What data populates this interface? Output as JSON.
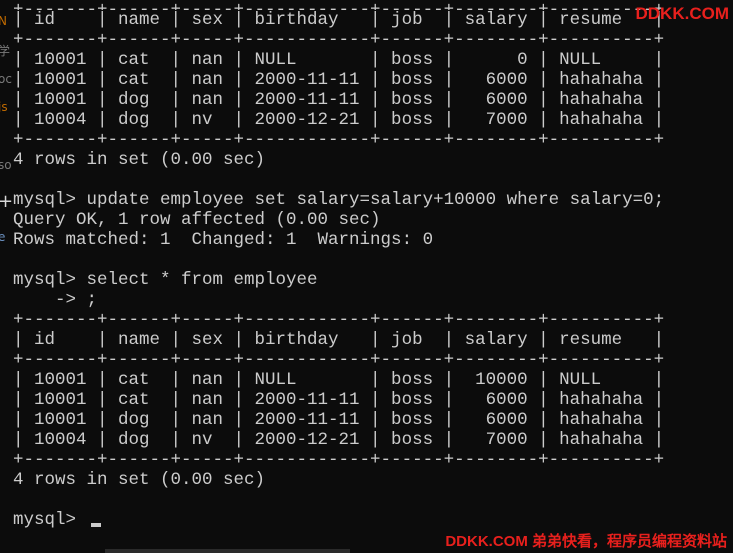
{
  "terminal": {
    "lines": [
      "| id    | name | sex | birthday   | job  | salary | resume   |",
      "+-------+------+-----+------------+------+--------+----------+",
      "| 10001 | cat  | nan | NULL       | boss |      0 | NULL     |",
      "| 10001 | cat  | nan | 2000-11-11 | boss |   6000 | hahahaha |",
      "| 10001 | dog  | nan | 2000-11-11 | boss |   6000 | hahahaha |",
      "| 10004 | dog  | nv  | 2000-12-21 | boss |   7000 | hahahaha |",
      "+-------+------+-----+------------+------+--------+----------+",
      "4 rows in set (0.00 sec)",
      "",
      "mysql> update employee set salary=salary+10000 where salary=0;",
      "Query OK, 1 row affected (0.00 sec)",
      "Rows matched: 1  Changed: 1  Warnings: 0",
      "",
      "mysql> select * from employee",
      "    -> ;",
      "+-------+------+-----+------------+------+--------+----------+",
      "| id    | name | sex | birthday   | job  | salary | resume   |",
      "+-------+------+-----+------------+------+--------+----------+",
      "| 10001 | cat  | nan | NULL       | boss |  10000 | NULL     |",
      "| 10001 | cat  | nan | 2000-11-11 | boss |   6000 | hahahaha |",
      "| 10001 | dog  | nan | 2000-11-11 | boss |   6000 | hahahaha |",
      "| 10004 | dog  | nv  | 2000-12-21 | boss |   7000 | hahahaha |",
      "+-------+------+-----+------------+------+--------+----------+",
      "4 rows in set (0.00 sec)",
      "",
      "mysql> "
    ]
  },
  "watermark": {
    "top": "DDKK.COM",
    "bottom": "DDKK.COM 弟弟快看，程序员编程资料站"
  },
  "left_edge_fragments": [
    "N",
    "学",
    "oc",
    "js",
    "so",
    "+",
    "e"
  ],
  "colors": {
    "background": "#0c0c0c",
    "text": "#cccccc",
    "watermark": "#e8201d"
  }
}
